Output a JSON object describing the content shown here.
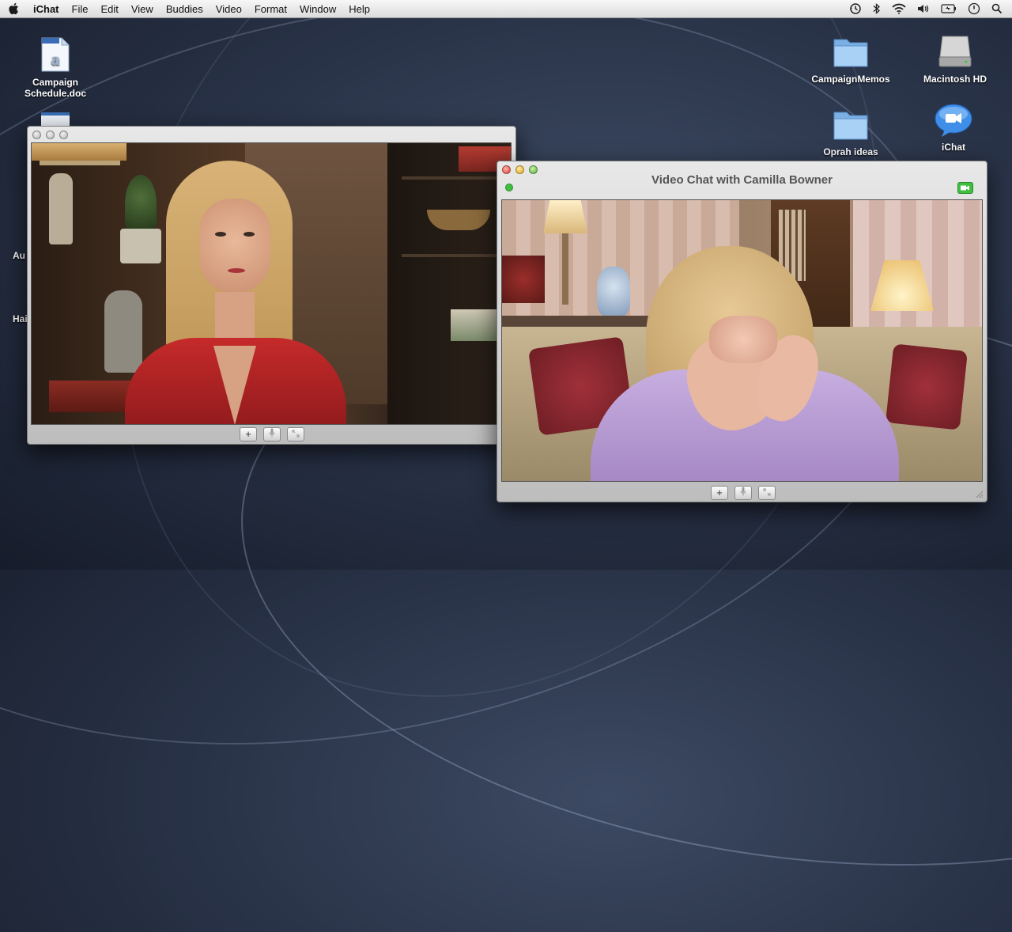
{
  "menubar": {
    "app": "iChat",
    "items": [
      "File",
      "Edit",
      "View",
      "Buddies",
      "Video",
      "Format",
      "Window",
      "Help"
    ]
  },
  "desktop": {
    "icons": [
      {
        "label": "Campaign\nSchedule.doc",
        "icon": "word-document-icon"
      },
      {
        "label": "CampaignMemos",
        "icon": "folder-icon"
      },
      {
        "label": "Macintosh HD",
        "icon": "hard-drive-icon"
      },
      {
        "label": "Oprah ideas",
        "icon": "folder-icon"
      },
      {
        "label": "iChat",
        "icon": "ichat-icon"
      }
    ],
    "edge_labels": [
      "Au",
      "Hai"
    ]
  },
  "video_chat": {
    "title": "Video Chat with Camilla Bowner",
    "controls": [
      "+",
      "mic",
      "fullscreen"
    ]
  },
  "colors": {
    "accent_green": "#3fbf3f",
    "desktop_blue": "#2a3449",
    "jacket_red": "#b41d20",
    "blouse_lilac": "#b89bd0"
  }
}
